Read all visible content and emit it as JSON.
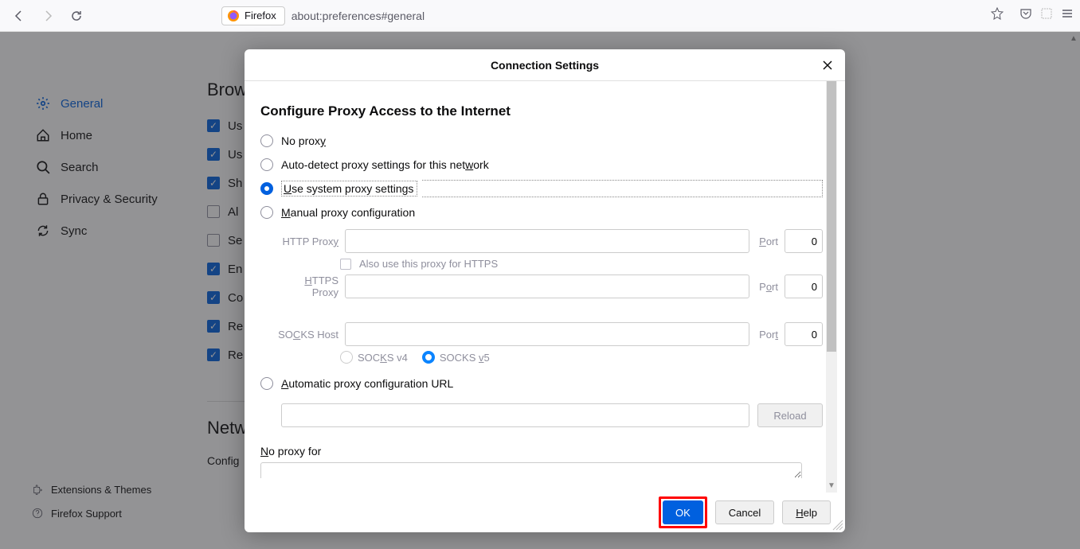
{
  "toolbar": {
    "identity_label": "Firefox",
    "url": "about:preferences#general"
  },
  "sidebar": {
    "items": [
      {
        "label": "General"
      },
      {
        "label": "Home"
      },
      {
        "label": "Search"
      },
      {
        "label": "Privacy & Security"
      },
      {
        "label": "Sync"
      }
    ],
    "bottom": [
      {
        "label": "Extensions & Themes"
      },
      {
        "label": "Firefox Support"
      }
    ]
  },
  "main": {
    "heading_partial": "Brow",
    "checks": [
      {
        "checked": true,
        "label": "Us"
      },
      {
        "checked": true,
        "label": "Us"
      },
      {
        "checked": true,
        "label": "Sh"
      },
      {
        "checked": false,
        "label": "Al"
      },
      {
        "checked": false,
        "label": "Se"
      },
      {
        "checked": true,
        "label": "En"
      },
      {
        "checked": true,
        "label": "Co"
      },
      {
        "checked": true,
        "label": "Re"
      },
      {
        "checked": true,
        "label": "Re"
      }
    ],
    "network_heading": "Netw",
    "config_line": "Config"
  },
  "dialog": {
    "title": "Connection Settings",
    "section": "Configure Proxy Access to the Internet",
    "radios": {
      "no_proxy": "No proxy",
      "auto_detect": "Auto-detect proxy settings for this network",
      "use_system": "Use system proxy settings",
      "manual": "Manual proxy configuration",
      "automatic_url": "Automatic proxy configuration URL"
    },
    "proxy": {
      "http_label": "HTTP Proxy",
      "https_label": "HTTPS Proxy",
      "socks_label": "SOCKS Host",
      "port_label": "Port",
      "port_value": "0",
      "also_https": "Also use this proxy for HTTPS",
      "socks_v4": "SOCKS v4",
      "socks_v5": "SOCKS v5"
    },
    "reload": "Reload",
    "no_proxy_for": "No proxy for",
    "buttons": {
      "ok": "OK",
      "cancel": "Cancel",
      "help": "Help"
    }
  }
}
